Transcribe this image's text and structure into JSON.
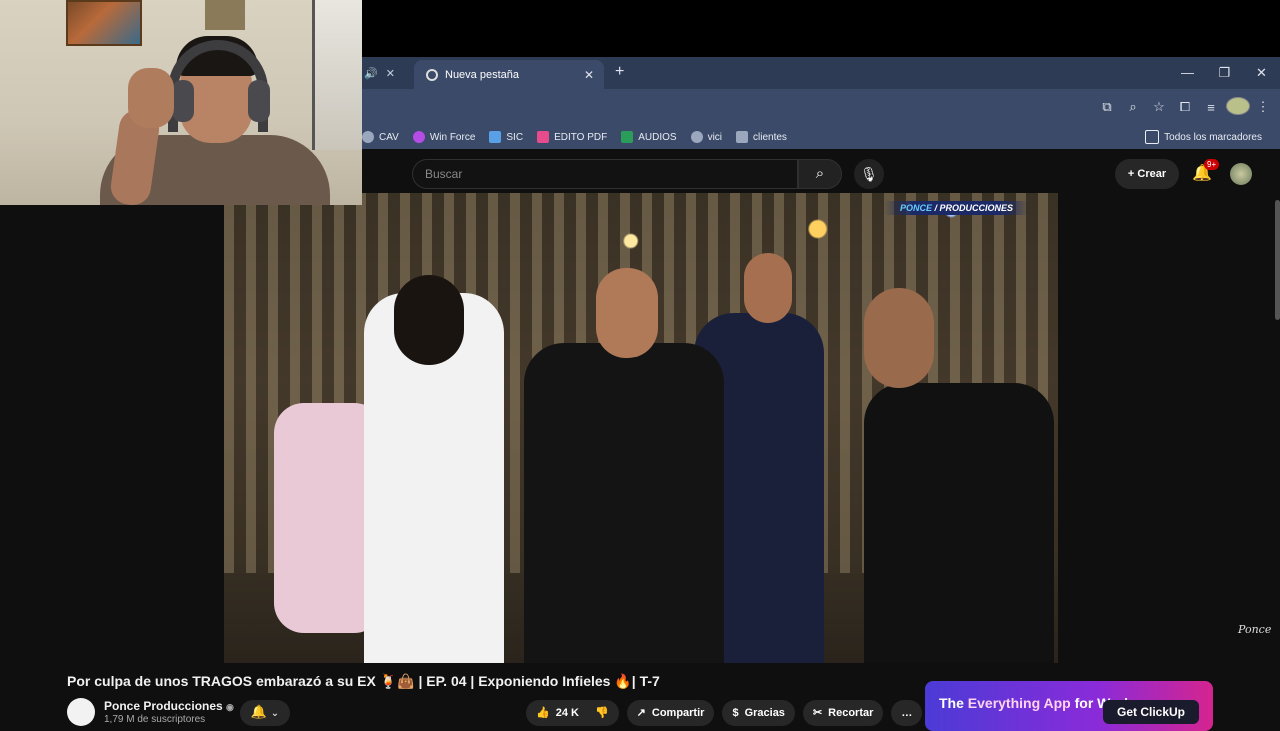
{
  "browser": {
    "tabs": [
      {
        "label": "Nueva pestaña",
        "active": true
      }
    ],
    "new_tab_symbol": "+",
    "window_controls": [
      "—",
      "❐",
      "✕"
    ],
    "bookmarks": [
      {
        "label": "CAV",
        "icon": "chrome-icon",
        "color": "#9aa7bd"
      },
      {
        "label": "Win Force",
        "icon": "winforce-icon",
        "color": "#b54ce6"
      },
      {
        "label": "SIC",
        "icon": "sic-icon",
        "color": "#5aa0e6"
      },
      {
        "label": "EDITO PDF",
        "icon": "pdf-icon",
        "color": "#e64c8c"
      },
      {
        "label": "AUDIOS",
        "icon": "audio-icon",
        "color": "#2a9d5a"
      },
      {
        "label": "vici",
        "icon": "vici-icon",
        "color": "#9aa7bd"
      },
      {
        "label": "clientes",
        "icon": "clientes-icon",
        "color": "#9aa7bd"
      }
    ],
    "all_bookmarks_label": "Todos los marcadores"
  },
  "youtube": {
    "search_placeholder": "Buscar",
    "create_label": "Crear",
    "notification_badge": "9+",
    "video": {
      "brand_left": "PONCE",
      "brand_right": "PRODUCCIONES",
      "watermark": "Ponce"
    },
    "title": "Por culpa de unos TRAGOS embarazó a su EX 🍹👜 | EP. 04 | Exponiendo Infieles 🔥| T-7",
    "channel": {
      "name": "Ponce Producciones",
      "subscribers": "1,79 M de suscriptores"
    },
    "actions": {
      "likes": "24 K",
      "share": "Compartir",
      "thanks": "Gracias",
      "clip": "Recortar",
      "more": "…"
    },
    "ad": {
      "headline_prefix": "The ",
      "headline_highlight": "Everything App",
      "headline_suffix": " for Work",
      "button": "Get  ClickUp"
    }
  }
}
